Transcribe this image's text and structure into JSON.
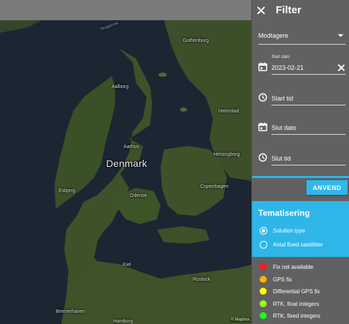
{
  "map": {
    "country": "Denmark",
    "attribution": "© Mapbox",
    "sea_labels": [
      "Skagerrak"
    ],
    "cities": [
      "Gothenburg",
      "Aalborg",
      "Halmstad",
      "Aarhus",
      "Helsingborg",
      "Copenhagen",
      "Esbjerg",
      "Odense",
      "Kiel",
      "Rostock",
      "Bremerhaven",
      "Hamburg"
    ]
  },
  "panel": {
    "title": "Filter",
    "receivers_select": "Modtagere",
    "start_date_label": "Start dato",
    "start_date_value": "2023-02-21",
    "start_time_placeholder": "Start tid",
    "end_date_placeholder": "Slut dato",
    "end_time_placeholder": "Slut tid",
    "apply_label": "ANVEND",
    "theme": {
      "title": "Tematisering",
      "options": [
        {
          "label": "Solution type",
          "checked": true
        },
        {
          "label": "Antal fixed satellitter",
          "checked": false
        }
      ]
    },
    "legend": [
      {
        "label": "Fix not available",
        "color": "#ff1a1a"
      },
      {
        "label": "GPS fix",
        "color": "#ffb300"
      },
      {
        "label": "Differential GPS fix",
        "color": "#ffff00"
      },
      {
        "label": "RTK, float integers",
        "color": "#9cff1a"
      },
      {
        "label": "RTK, fixed integers",
        "color": "#1aff1a"
      }
    ]
  },
  "colors": {
    "panel_bg": "#616161",
    "accent": "#2fb6e9",
    "map_water": "#1b2632",
    "map_land": "#3b4d25"
  }
}
